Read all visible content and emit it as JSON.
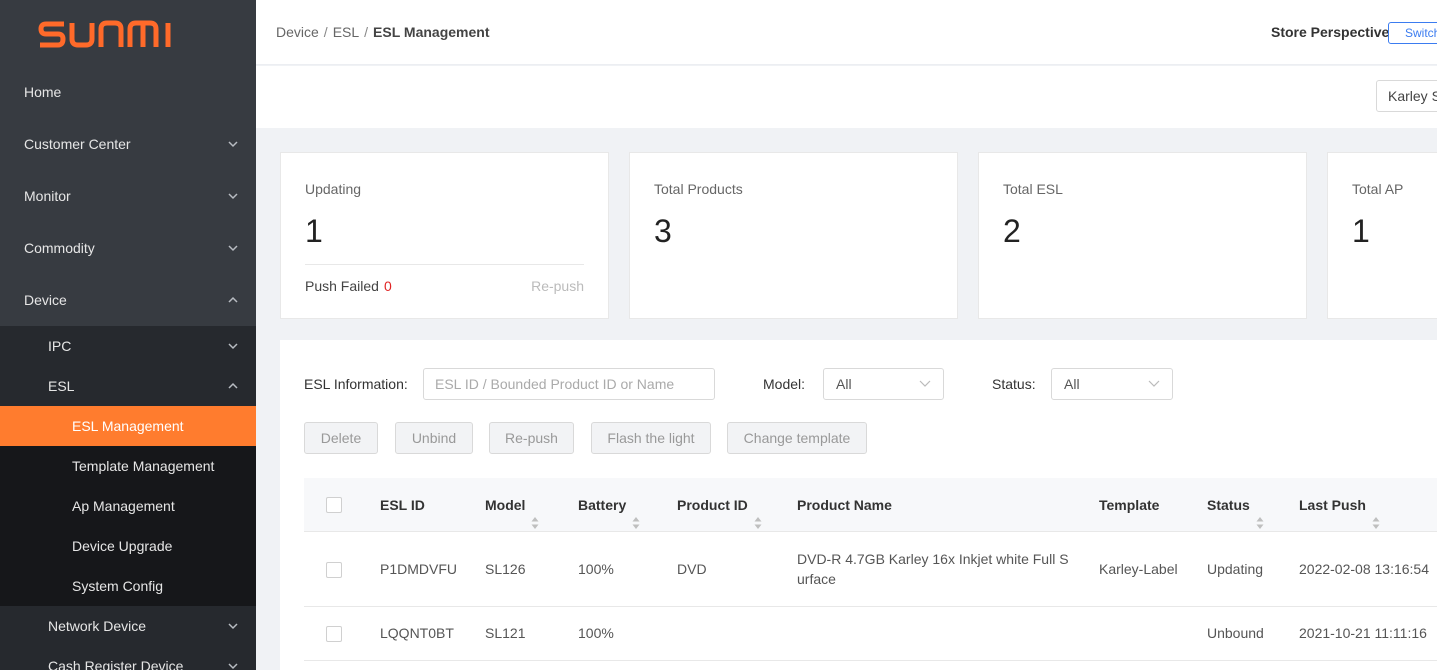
{
  "app": {
    "brand": "SUNMI",
    "brand_color": "#ff6a2a",
    "accent": "#ff7c2e"
  },
  "sidebar": {
    "items": [
      {
        "label": "Home",
        "icon": null
      },
      {
        "label": "Customer Center",
        "icon": "chevron-down-icon"
      },
      {
        "label": "Monitor",
        "icon": "chevron-down-icon"
      },
      {
        "label": "Commodity",
        "icon": "chevron-down-icon"
      },
      {
        "label": "Device",
        "icon": "chevron-up-icon"
      }
    ],
    "device_children": [
      {
        "label": "IPC",
        "icon": "chevron-down-icon"
      },
      {
        "label": "ESL",
        "icon": "chevron-up-icon"
      }
    ],
    "esl_children": [
      {
        "label": "ESL Management",
        "active": true
      },
      {
        "label": "Template Management"
      },
      {
        "label": "Ap Management"
      },
      {
        "label": "Device Upgrade"
      },
      {
        "label": "System Config"
      }
    ],
    "device_children_after": [
      {
        "label": "Network Device",
        "icon": "chevron-down-icon"
      },
      {
        "label": "Cash Register Device",
        "icon": "chevron-down-icon"
      }
    ]
  },
  "header": {
    "breadcrumb": [
      "Device",
      "ESL",
      "ESL Management"
    ],
    "breadcrumb_sep": "/",
    "perspective_label": "Store Perspective",
    "switch_label": "Switch",
    "store_select": "Karley S"
  },
  "stats": [
    {
      "label": "Updating",
      "value": "1",
      "push_failed_label": "Push Failed",
      "push_failed_count": "0",
      "repush_label": "Re-push"
    },
    {
      "label": "Total Products",
      "value": "3"
    },
    {
      "label": "Total ESL",
      "value": "2"
    },
    {
      "label": "Total AP",
      "value": "1"
    }
  ],
  "filters": {
    "esl_info_label": "ESL Information:",
    "esl_info_placeholder": "ESL ID / Bounded Product ID or Name",
    "model_label": "Model:",
    "model_value": "All",
    "status_label": "Status:",
    "status_value": "All"
  },
  "actions": [
    "Delete",
    "Unbind",
    "Re-push",
    "Flash the light",
    "Change template"
  ],
  "table": {
    "columns": [
      "ESL ID",
      "Model",
      "Battery",
      "Product ID",
      "Product Name",
      "Template",
      "Status",
      "Last Push"
    ],
    "rows": [
      {
        "esl_id": "P1DMDVFU",
        "model": "SL126",
        "battery": "100%",
        "product_id": "DVD",
        "product_name": "DVD-R 4.7GB Karley 16x Inkjet white Full Surface",
        "template": "Karley-Label",
        "status": "Updating",
        "last_push": "2022-02-08 13:16:54"
      },
      {
        "esl_id": "LQQNT0BT",
        "model": "SL121",
        "battery": "100%",
        "product_id": "",
        "product_name": "",
        "template": "",
        "status": "Unbound",
        "last_push": "2021-10-21 11:11:16"
      }
    ]
  }
}
